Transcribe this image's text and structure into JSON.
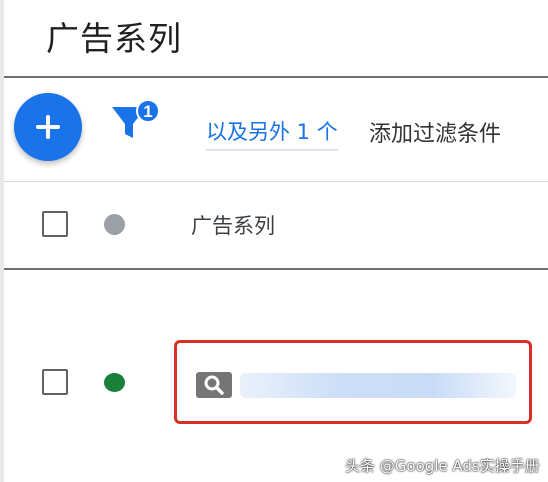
{
  "header": {
    "title": "广告系列"
  },
  "toolbar": {
    "filter_count": "1",
    "filter_link_label": "以及另外 1 个",
    "add_filter_label": "添加过滤条件"
  },
  "table": {
    "column_header": "广告系列",
    "rows": [
      {
        "status": "enabled",
        "status_color": "#188038",
        "campaign_type_icon": "search-icon",
        "name": ""
      }
    ],
    "header_status_color": "#9aa0a6"
  },
  "colors": {
    "accent": "#1a73e8",
    "highlight": "#d93025"
  },
  "watermark": "头条 @Google Ads实操手册"
}
